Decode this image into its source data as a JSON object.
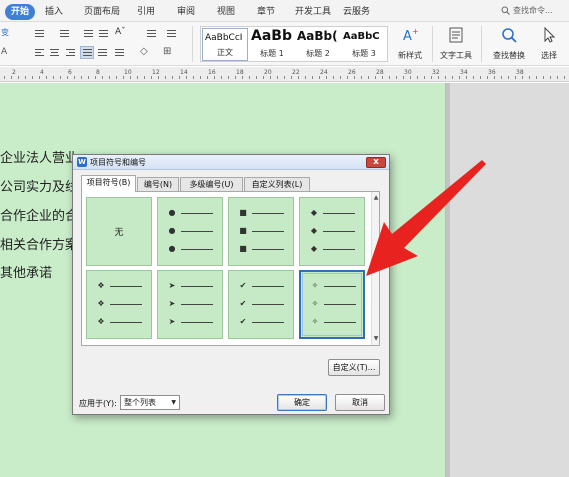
{
  "ribbon": {
    "tabs": [
      {
        "label": "开始",
        "active": true
      },
      {
        "label": "插入"
      },
      {
        "label": "页面布局"
      },
      {
        "label": "引用"
      },
      {
        "label": "审阅"
      },
      {
        "label": "视图"
      },
      {
        "label": "章节"
      },
      {
        "label": "开发工具"
      },
      {
        "label": "云服务"
      }
    ],
    "search_label": "查找命令..."
  },
  "toolbar": {
    "left_partial_label": "变",
    "styles": [
      {
        "sample": "AaBbCcI",
        "label": "正文"
      },
      {
        "sample": "AaBb",
        "label": "标题 1"
      },
      {
        "sample": "AaBb(",
        "label": "标题 2"
      },
      {
        "sample": "AaBbC",
        "label": "标题 3"
      }
    ],
    "new_style_label": "新样式",
    "text_tools_label": "文字工具",
    "find_replace_label": "查找替换",
    "select_label": "选择"
  },
  "ruler": {
    "numbers": [
      "2",
      "4",
      "6",
      "8",
      "10",
      "12",
      "14",
      "16",
      "18",
      "20",
      "22",
      "24",
      "26",
      "28",
      "30",
      "32",
      "34",
      "36",
      "38"
    ]
  },
  "document": {
    "lines": [
      "企业法人营业",
      "公司实力及线",
      "合作企业的合",
      "相关合作方案",
      "其他承诺"
    ]
  },
  "dialog": {
    "title": "项目符号和编号",
    "close_label": "x",
    "tabs": [
      "项目符号(B)",
      "编号(N)",
      "多级编号(U)",
      "自定义列表(L)"
    ],
    "none_label": "无",
    "bullet_styles": [
      {
        "name": "none"
      },
      {
        "name": "filled-circle",
        "glyph": "●"
      },
      {
        "name": "filled-square",
        "glyph": "■"
      },
      {
        "name": "filled-diamond",
        "glyph": "◆"
      },
      {
        "name": "four-diamond",
        "glyph": "❖"
      },
      {
        "name": "arrowhead",
        "glyph": "➤"
      },
      {
        "name": "checkmark",
        "glyph": "✔"
      },
      {
        "name": "hollow-four-star",
        "glyph": "✧",
        "selected": true
      }
    ],
    "customize_label": "自定义(T)...",
    "apply_to_label": "应用于(Y):",
    "apply_to_value": "整个列表",
    "ok_label": "确定",
    "cancel_label": "取消"
  },
  "annotation": {
    "arrow_color": "#e8231f"
  }
}
